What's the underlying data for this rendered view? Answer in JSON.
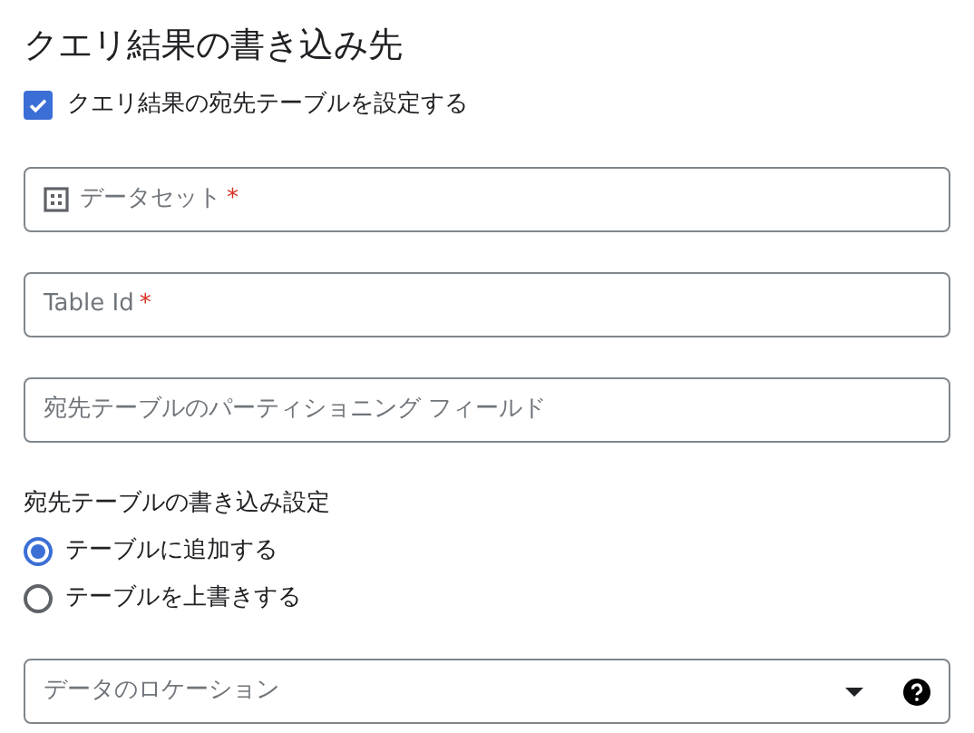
{
  "title": "クエリ結果の書き込み先",
  "destination_checkbox": {
    "label": "クエリ結果の宛先テーブルを設定する",
    "checked": true
  },
  "fields": [
    {
      "kind": "icon-text",
      "placeholder": "データセット",
      "required_mark": "*"
    },
    {
      "kind": "text",
      "placeholder": "Table Id",
      "required_mark": "*"
    },
    {
      "kind": "text",
      "placeholder": "宛先テーブルのパーティショニング フィールド"
    }
  ],
  "write_preference": {
    "label": "宛先テーブルの書き込み設定",
    "options": [
      {
        "label": "テーブルに追加する",
        "selected": true
      },
      {
        "label": "テーブルを上書きする",
        "selected": false
      }
    ]
  },
  "location_select": {
    "placeholder": "データのロケーション"
  }
}
